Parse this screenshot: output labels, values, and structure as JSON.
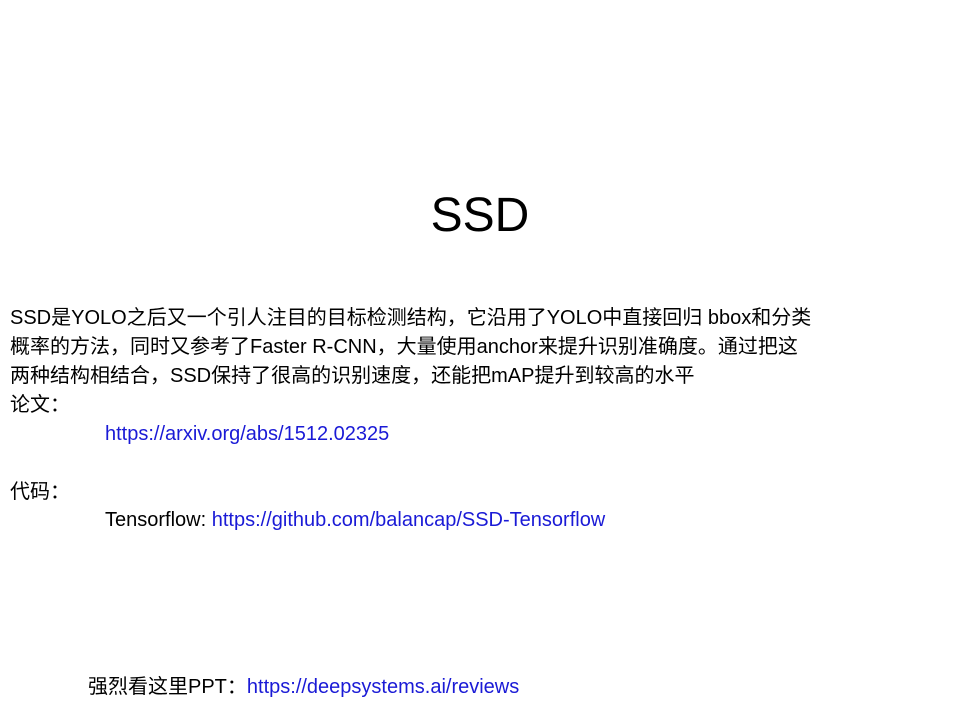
{
  "slide": {
    "title": "SSD",
    "paragraph_lines": [
      "SSD是YOLO之后又一个引人注目的目标检测结构，它沿用了YOLO中直接回归 bbox和分类",
      "概率的方法，同时又参考了Faster R-CNN，大量使用anchor来提升识别准确度。通过把这",
      "两种结构相结合，SSD保持了很高的识别速度，还能把mAP提升到较高的水平"
    ],
    "paper_label": "论文：",
    "paper_link": "https://arxiv.org/abs/1512.02325",
    "code_label": "代码：",
    "code_prefix": "Tensorflow: ",
    "code_link": "https://github.com/balancap/SSD-Tensorflow",
    "footer_prefix": "强烈看这里PPT：",
    "footer_link": "https://deepsystems.ai/reviews"
  },
  "colors": {
    "text": "#000000",
    "link": "#1a1ad6",
    "background": "#ffffff"
  }
}
